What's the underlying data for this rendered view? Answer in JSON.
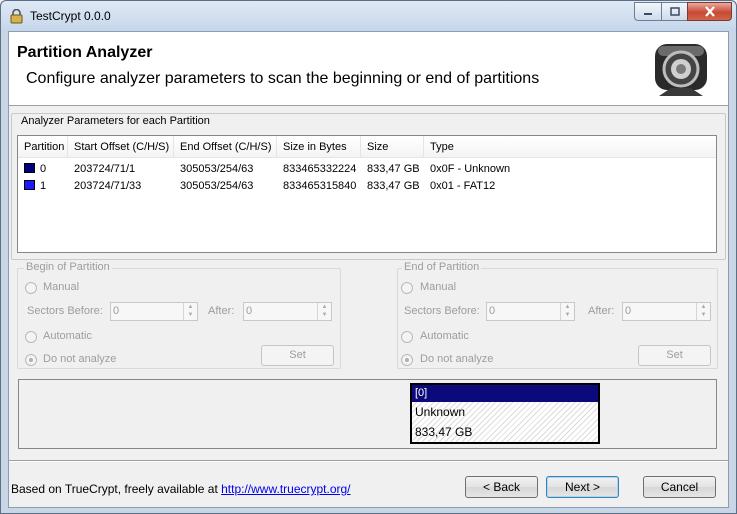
{
  "window": {
    "title": "TestCrypt 0.0.0"
  },
  "header": {
    "title": "Partition Analyzer",
    "subtitle": "Configure analyzer parameters to scan the beginning or end of partitions"
  },
  "params_group": {
    "label": "Analyzer Parameters for each Partition",
    "columns": [
      "Partition",
      "Start Offset (C/H/S)",
      "End Offset (C/H/S)",
      "Size in Bytes",
      "Size",
      "Type"
    ],
    "rows": [
      {
        "partition": "0",
        "color": "#00007a",
        "start": "203724/71/1",
        "end": "305053/254/63",
        "bytes": "833465332224",
        "size": "833,47 GB",
        "type": "0x0F - Unknown"
      },
      {
        "partition": "1",
        "color": "#1a1aff",
        "start": "203724/71/33",
        "end": "305053/254/63",
        "bytes": "833465315840",
        "size": "833,47 GB",
        "type": "0x01 - FAT12"
      }
    ]
  },
  "begin": {
    "label": "Begin of Partition",
    "manual": "Manual",
    "sectors_before": "Sectors Before:",
    "before_value": "0",
    "after": "After:",
    "after_value": "0",
    "automatic": "Automatic",
    "do_not_analyze": "Do not analyze",
    "set": "Set"
  },
  "end": {
    "label": "End of Partition",
    "manual": "Manual",
    "sectors_before": "Sectors Before:",
    "before_value": "0",
    "after": "After:",
    "after_value": "0",
    "automatic": "Automatic",
    "do_not_analyze": "Do not analyze",
    "set": "Set"
  },
  "info": {
    "header": "[0]",
    "line1": "Unknown",
    "line2": "833,47 GB",
    "header_color": "#0a0a7a"
  },
  "footer": {
    "text": "Based on TrueCrypt, freely available at ",
    "link": "http://www.truecrypt.org/",
    "back": "< Back",
    "next": "Next >",
    "cancel": "Cancel"
  }
}
